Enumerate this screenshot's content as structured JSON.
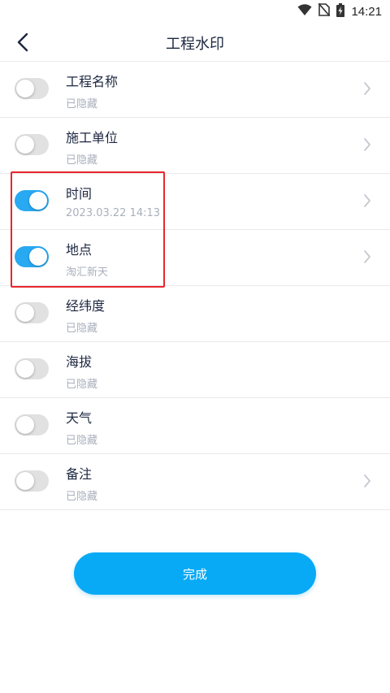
{
  "status_bar": {
    "time": "14:21",
    "icons": [
      "wifi-icon",
      "no-sim-icon",
      "battery-charging-icon"
    ]
  },
  "header": {
    "title": "工程水印",
    "back_icon": "chevron-left-icon"
  },
  "rows": [
    {
      "title": "工程名称",
      "subtitle": "已隐藏",
      "enabled": false,
      "has_chevron": true
    },
    {
      "title": "施工单位",
      "subtitle": "已隐藏",
      "enabled": false,
      "has_chevron": true
    },
    {
      "title": "时间",
      "subtitle": "2023.03.22 14:13",
      "enabled": true,
      "has_chevron": true
    },
    {
      "title": "地点",
      "subtitle": "淘汇新天",
      "enabled": true,
      "has_chevron": true
    },
    {
      "title": "经纬度",
      "subtitle": "已隐藏",
      "enabled": false,
      "has_chevron": false
    },
    {
      "title": "海拔",
      "subtitle": "已隐藏",
      "enabled": false,
      "has_chevron": false
    },
    {
      "title": "天气",
      "subtitle": "已隐藏",
      "enabled": false,
      "has_chevron": false
    },
    {
      "title": "备注",
      "subtitle": "已隐藏",
      "enabled": false,
      "has_chevron": true
    }
  ],
  "done_button": {
    "label": "完成"
  },
  "colors": {
    "toggle_on": "#28a9f2",
    "toggle_off": "#e1e1e1",
    "primary_button": "#08aaf5",
    "highlight": "#e8262e"
  }
}
